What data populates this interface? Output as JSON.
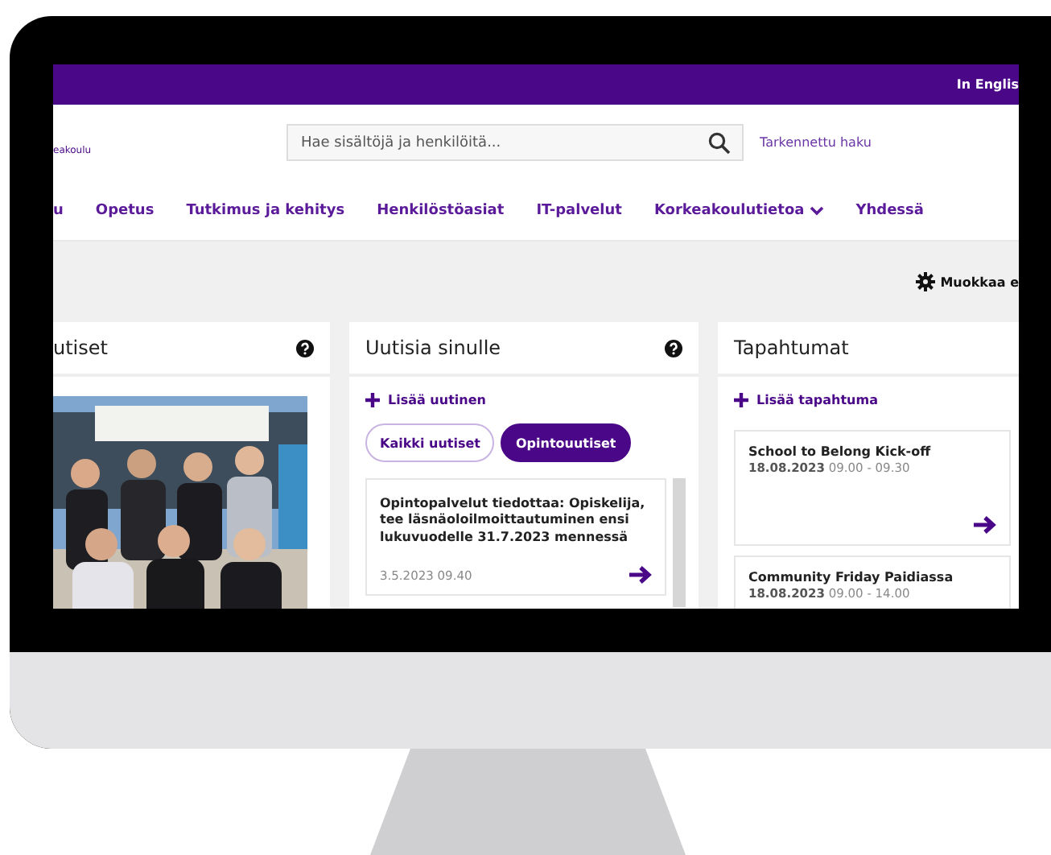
{
  "topbar": {
    "language_link": "In Englis"
  },
  "header": {
    "logo_text": "eakoulu",
    "search": {
      "placeholder": "Hae sisältöjä ja henkilöitä..."
    },
    "advanced_search": "Tarkennettu haku"
  },
  "nav": {
    "items": [
      {
        "label": "u",
        "dropdown": false
      },
      {
        "label": "Opetus",
        "dropdown": false
      },
      {
        "label": "Tutkimus ja kehitys",
        "dropdown": false
      },
      {
        "label": "Henkilöstöasiat",
        "dropdown": false
      },
      {
        "label": "IT-palvelut",
        "dropdown": false
      },
      {
        "label": "Korkeakoulutietoa",
        "dropdown": true
      },
      {
        "label": "Yhdessä",
        "dropdown": false
      }
    ]
  },
  "toolbar": {
    "edit_button": "Muokkaa e"
  },
  "cards": [
    {
      "title": "utiset",
      "help": true
    },
    {
      "kind": "news",
      "title": "Uutisia sinulle",
      "help": true,
      "add_link": "Lisää uutinen",
      "filters": [
        {
          "label": "Kaikki uutiset",
          "selected": false
        },
        {
          "label": "Opintouutiset",
          "selected": true
        }
      ],
      "items": [
        {
          "title": "Opintopalvelut tiedottaa: Opiskelija, tee läsnäoloilmoittautuminen ensi lukuvuodelle 31.7.2023 mennessä",
          "date": "3.5.2023 09.40"
        }
      ]
    },
    {
      "kind": "events",
      "title": "Tapahtumat",
      "add_link": "Lisää tapahtuma",
      "items": [
        {
          "title": "School to Belong Kick-off",
          "date": "18.08.2023",
          "time": "09.00 - 09.30"
        },
        {
          "title": "Community Friday Paidiassa",
          "date": "18.08.2023",
          "time": "09.00 - 14.00"
        }
      ]
    }
  ]
}
